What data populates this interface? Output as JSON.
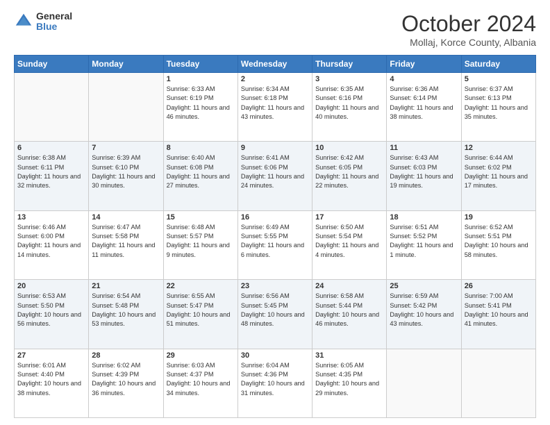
{
  "header": {
    "logo_general": "General",
    "logo_blue": "Blue",
    "month_title": "October 2024",
    "location": "Mollaj, Korce County, Albania"
  },
  "weekdays": [
    "Sunday",
    "Monday",
    "Tuesday",
    "Wednesday",
    "Thursday",
    "Friday",
    "Saturday"
  ],
  "weeks": [
    [
      null,
      null,
      {
        "day": 1,
        "sunrise": "6:33 AM",
        "sunset": "6:19 PM",
        "daylight": "11 hours and 46 minutes."
      },
      {
        "day": 2,
        "sunrise": "6:34 AM",
        "sunset": "6:18 PM",
        "daylight": "11 hours and 43 minutes."
      },
      {
        "day": 3,
        "sunrise": "6:35 AM",
        "sunset": "6:16 PM",
        "daylight": "11 hours and 40 minutes."
      },
      {
        "day": 4,
        "sunrise": "6:36 AM",
        "sunset": "6:14 PM",
        "daylight": "11 hours and 38 minutes."
      },
      {
        "day": 5,
        "sunrise": "6:37 AM",
        "sunset": "6:13 PM",
        "daylight": "11 hours and 35 minutes."
      }
    ],
    [
      {
        "day": 6,
        "sunrise": "6:38 AM",
        "sunset": "6:11 PM",
        "daylight": "11 hours and 32 minutes."
      },
      {
        "day": 7,
        "sunrise": "6:39 AM",
        "sunset": "6:10 PM",
        "daylight": "11 hours and 30 minutes."
      },
      {
        "day": 8,
        "sunrise": "6:40 AM",
        "sunset": "6:08 PM",
        "daylight": "11 hours and 27 minutes."
      },
      {
        "day": 9,
        "sunrise": "6:41 AM",
        "sunset": "6:06 PM",
        "daylight": "11 hours and 24 minutes."
      },
      {
        "day": 10,
        "sunrise": "6:42 AM",
        "sunset": "6:05 PM",
        "daylight": "11 hours and 22 minutes."
      },
      {
        "day": 11,
        "sunrise": "6:43 AM",
        "sunset": "6:03 PM",
        "daylight": "11 hours and 19 minutes."
      },
      {
        "day": 12,
        "sunrise": "6:44 AM",
        "sunset": "6:02 PM",
        "daylight": "11 hours and 17 minutes."
      }
    ],
    [
      {
        "day": 13,
        "sunrise": "6:46 AM",
        "sunset": "6:00 PM",
        "daylight": "11 hours and 14 minutes."
      },
      {
        "day": 14,
        "sunrise": "6:47 AM",
        "sunset": "5:58 PM",
        "daylight": "11 hours and 11 minutes."
      },
      {
        "day": 15,
        "sunrise": "6:48 AM",
        "sunset": "5:57 PM",
        "daylight": "11 hours and 9 minutes."
      },
      {
        "day": 16,
        "sunrise": "6:49 AM",
        "sunset": "5:55 PM",
        "daylight": "11 hours and 6 minutes."
      },
      {
        "day": 17,
        "sunrise": "6:50 AM",
        "sunset": "5:54 PM",
        "daylight": "11 hours and 4 minutes."
      },
      {
        "day": 18,
        "sunrise": "6:51 AM",
        "sunset": "5:52 PM",
        "daylight": "11 hours and 1 minute."
      },
      {
        "day": 19,
        "sunrise": "6:52 AM",
        "sunset": "5:51 PM",
        "daylight": "10 hours and 58 minutes."
      }
    ],
    [
      {
        "day": 20,
        "sunrise": "6:53 AM",
        "sunset": "5:50 PM",
        "daylight": "10 hours and 56 minutes."
      },
      {
        "day": 21,
        "sunrise": "6:54 AM",
        "sunset": "5:48 PM",
        "daylight": "10 hours and 53 minutes."
      },
      {
        "day": 22,
        "sunrise": "6:55 AM",
        "sunset": "5:47 PM",
        "daylight": "10 hours and 51 minutes."
      },
      {
        "day": 23,
        "sunrise": "6:56 AM",
        "sunset": "5:45 PM",
        "daylight": "10 hours and 48 minutes."
      },
      {
        "day": 24,
        "sunrise": "6:58 AM",
        "sunset": "5:44 PM",
        "daylight": "10 hours and 46 minutes."
      },
      {
        "day": 25,
        "sunrise": "6:59 AM",
        "sunset": "5:42 PM",
        "daylight": "10 hours and 43 minutes."
      },
      {
        "day": 26,
        "sunrise": "7:00 AM",
        "sunset": "5:41 PM",
        "daylight": "10 hours and 41 minutes."
      }
    ],
    [
      {
        "day": 27,
        "sunrise": "6:01 AM",
        "sunset": "4:40 PM",
        "daylight": "10 hours and 38 minutes."
      },
      {
        "day": 28,
        "sunrise": "6:02 AM",
        "sunset": "4:39 PM",
        "daylight": "10 hours and 36 minutes."
      },
      {
        "day": 29,
        "sunrise": "6:03 AM",
        "sunset": "4:37 PM",
        "daylight": "10 hours and 34 minutes."
      },
      {
        "day": 30,
        "sunrise": "6:04 AM",
        "sunset": "4:36 PM",
        "daylight": "10 hours and 31 minutes."
      },
      {
        "day": 31,
        "sunrise": "6:05 AM",
        "sunset": "4:35 PM",
        "daylight": "10 hours and 29 minutes."
      },
      null,
      null
    ]
  ]
}
